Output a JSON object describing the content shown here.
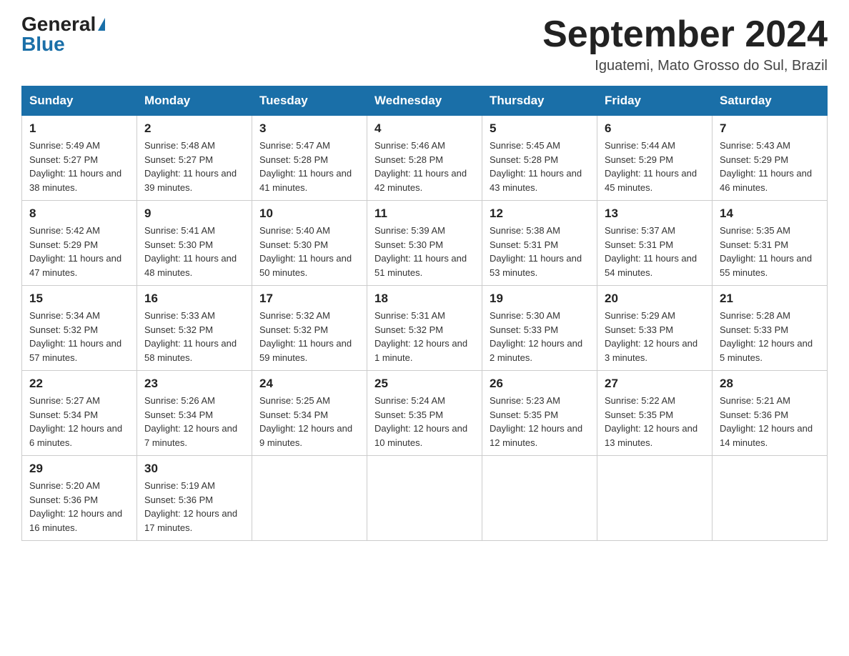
{
  "header": {
    "logo_general": "General",
    "logo_blue": "Blue",
    "month_title": "September 2024",
    "subtitle": "Iguatemi, Mato Grosso do Sul, Brazil"
  },
  "weekdays": [
    "Sunday",
    "Monday",
    "Tuesday",
    "Wednesday",
    "Thursday",
    "Friday",
    "Saturday"
  ],
  "weeks": [
    [
      {
        "day": "1",
        "sunrise": "5:49 AM",
        "sunset": "5:27 PM",
        "daylight": "11 hours and 38 minutes."
      },
      {
        "day": "2",
        "sunrise": "5:48 AM",
        "sunset": "5:27 PM",
        "daylight": "11 hours and 39 minutes."
      },
      {
        "day": "3",
        "sunrise": "5:47 AM",
        "sunset": "5:28 PM",
        "daylight": "11 hours and 41 minutes."
      },
      {
        "day": "4",
        "sunrise": "5:46 AM",
        "sunset": "5:28 PM",
        "daylight": "11 hours and 42 minutes."
      },
      {
        "day": "5",
        "sunrise": "5:45 AM",
        "sunset": "5:28 PM",
        "daylight": "11 hours and 43 minutes."
      },
      {
        "day": "6",
        "sunrise": "5:44 AM",
        "sunset": "5:29 PM",
        "daylight": "11 hours and 45 minutes."
      },
      {
        "day": "7",
        "sunrise": "5:43 AM",
        "sunset": "5:29 PM",
        "daylight": "11 hours and 46 minutes."
      }
    ],
    [
      {
        "day": "8",
        "sunrise": "5:42 AM",
        "sunset": "5:29 PM",
        "daylight": "11 hours and 47 minutes."
      },
      {
        "day": "9",
        "sunrise": "5:41 AM",
        "sunset": "5:30 PM",
        "daylight": "11 hours and 48 minutes."
      },
      {
        "day": "10",
        "sunrise": "5:40 AM",
        "sunset": "5:30 PM",
        "daylight": "11 hours and 50 minutes."
      },
      {
        "day": "11",
        "sunrise": "5:39 AM",
        "sunset": "5:30 PM",
        "daylight": "11 hours and 51 minutes."
      },
      {
        "day": "12",
        "sunrise": "5:38 AM",
        "sunset": "5:31 PM",
        "daylight": "11 hours and 53 minutes."
      },
      {
        "day": "13",
        "sunrise": "5:37 AM",
        "sunset": "5:31 PM",
        "daylight": "11 hours and 54 minutes."
      },
      {
        "day": "14",
        "sunrise": "5:35 AM",
        "sunset": "5:31 PM",
        "daylight": "11 hours and 55 minutes."
      }
    ],
    [
      {
        "day": "15",
        "sunrise": "5:34 AM",
        "sunset": "5:32 PM",
        "daylight": "11 hours and 57 minutes."
      },
      {
        "day": "16",
        "sunrise": "5:33 AM",
        "sunset": "5:32 PM",
        "daylight": "11 hours and 58 minutes."
      },
      {
        "day": "17",
        "sunrise": "5:32 AM",
        "sunset": "5:32 PM",
        "daylight": "11 hours and 59 minutes."
      },
      {
        "day": "18",
        "sunrise": "5:31 AM",
        "sunset": "5:32 PM",
        "daylight": "12 hours and 1 minute."
      },
      {
        "day": "19",
        "sunrise": "5:30 AM",
        "sunset": "5:33 PM",
        "daylight": "12 hours and 2 minutes."
      },
      {
        "day": "20",
        "sunrise": "5:29 AM",
        "sunset": "5:33 PM",
        "daylight": "12 hours and 3 minutes."
      },
      {
        "day": "21",
        "sunrise": "5:28 AM",
        "sunset": "5:33 PM",
        "daylight": "12 hours and 5 minutes."
      }
    ],
    [
      {
        "day": "22",
        "sunrise": "5:27 AM",
        "sunset": "5:34 PM",
        "daylight": "12 hours and 6 minutes."
      },
      {
        "day": "23",
        "sunrise": "5:26 AM",
        "sunset": "5:34 PM",
        "daylight": "12 hours and 7 minutes."
      },
      {
        "day": "24",
        "sunrise": "5:25 AM",
        "sunset": "5:34 PM",
        "daylight": "12 hours and 9 minutes."
      },
      {
        "day": "25",
        "sunrise": "5:24 AM",
        "sunset": "5:35 PM",
        "daylight": "12 hours and 10 minutes."
      },
      {
        "day": "26",
        "sunrise": "5:23 AM",
        "sunset": "5:35 PM",
        "daylight": "12 hours and 12 minutes."
      },
      {
        "day": "27",
        "sunrise": "5:22 AM",
        "sunset": "5:35 PM",
        "daylight": "12 hours and 13 minutes."
      },
      {
        "day": "28",
        "sunrise": "5:21 AM",
        "sunset": "5:36 PM",
        "daylight": "12 hours and 14 minutes."
      }
    ],
    [
      {
        "day": "29",
        "sunrise": "5:20 AM",
        "sunset": "5:36 PM",
        "daylight": "12 hours and 16 minutes."
      },
      {
        "day": "30",
        "sunrise": "5:19 AM",
        "sunset": "5:36 PM",
        "daylight": "12 hours and 17 minutes."
      },
      null,
      null,
      null,
      null,
      null
    ]
  ]
}
